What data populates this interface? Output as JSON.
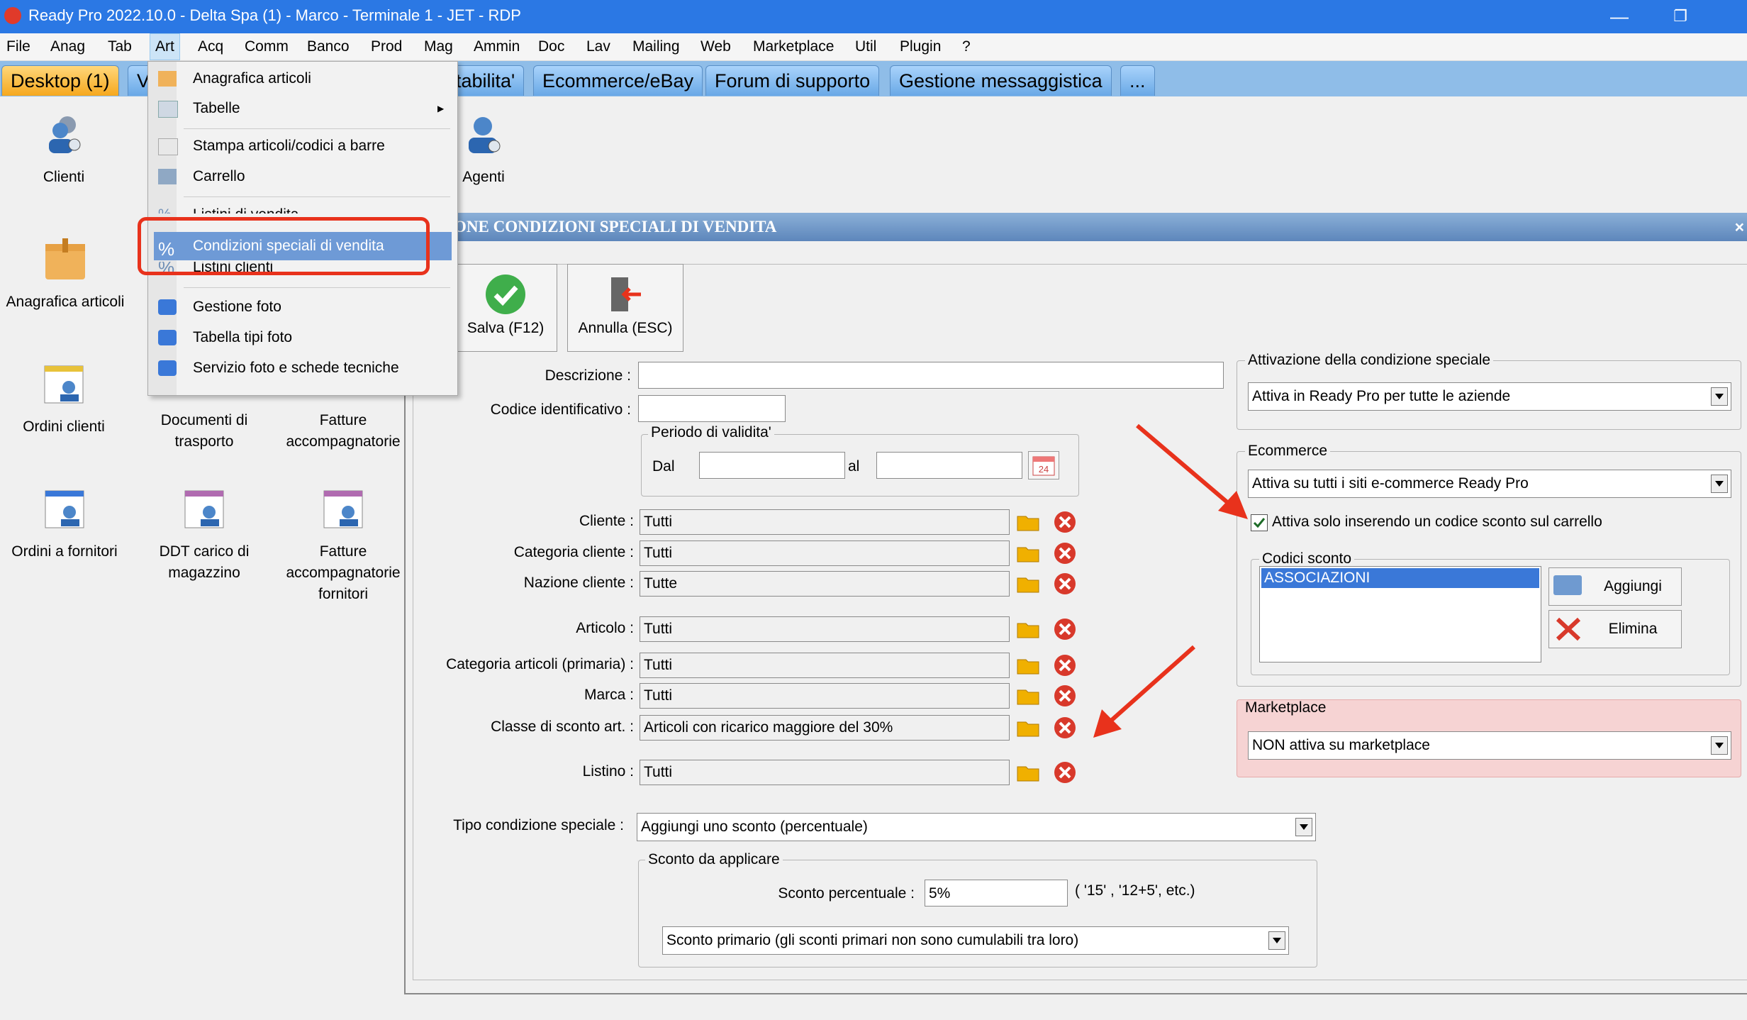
{
  "window": {
    "title": "Ready Pro 2022.10.0 - Delta Spa (1) - Marco - Terminale 1 - JET - RDP"
  },
  "menubar": [
    "File",
    "Anag",
    "Tab",
    "Art",
    "Acq",
    "Comm",
    "Banco",
    "Prod",
    "Mag",
    "Ammin",
    "Doc",
    "Lav",
    "Mailing",
    "Web",
    "Marketplace",
    "Util",
    "Plugin",
    "?"
  ],
  "tabs": [
    "Desktop (1)",
    "V",
    "tabilita'",
    "Ecommerce/eBay",
    "Forum di supporto",
    "Gestione messaggistica",
    "..."
  ],
  "desktop_icons": {
    "clienti": "Clienti",
    "anagrafica": "Anagrafica articoli",
    "agenti": "Agenti",
    "ordini_clienti": "Ordini clienti",
    "documenti_l1": "Documenti di",
    "documenti_l2": "trasporto",
    "fatture_l1": "Fatture",
    "fatture_l2": "accompagnatorie",
    "ordini_fornitori": "Ordini a fornitori",
    "ddt_l1": "DDT carico di",
    "ddt_l2": "magazzino",
    "fatt_forn_l1": "Fatture",
    "fatt_forn_l2": "accompagnatorie",
    "fatt_forn_l3": "fornitori"
  },
  "dropdown": {
    "items": [
      "Anagrafica articoli",
      "Tabelle",
      "Stampa articoli/codici a barre",
      "Carrello",
      "Listini di vendita",
      "Condizioni speciali di vendita",
      "Listini clienti",
      "Gestione foto",
      "Tabella tipi foto",
      "Servizio foto e schede tecniche"
    ],
    "submenu_arrow": "▶"
  },
  "panel": {
    "header": "ONE CONDIZIONI SPECIALI DI VENDITA",
    "save_label": "Salva (F12)",
    "cancel_label": "Annulla (ESC)",
    "descrizione_label": "Descrizione :",
    "codice_label": "Codice identificativo :",
    "periodo_title": "Periodo di validita'",
    "dal_label": "Dal",
    "al_label": "al",
    "calendar_day": "24",
    "rows": [
      {
        "label": "Cliente :",
        "value": "Tutti"
      },
      {
        "label": "Categoria cliente :",
        "value": "Tutti"
      },
      {
        "label": "Nazione cliente :",
        "value": "Tutte"
      },
      {
        "label": "Articolo :",
        "value": "Tutti"
      },
      {
        "label": "Categoria articoli (primaria) :",
        "value": "Tutti"
      },
      {
        "label": "Marca :",
        "value": "Tutti"
      },
      {
        "label": "Classe di sconto art. :",
        "value": "Articoli con ricarico maggiore del 30%"
      },
      {
        "label": "Listino :",
        "value": "Tutti"
      }
    ],
    "tipo_label": "Tipo condizione speciale :",
    "tipo_value": "Aggiungi uno sconto (percentuale)",
    "sconto_group": "Sconto da applicare",
    "sconto_label": "Sconto percentuale :",
    "sconto_value": "5%",
    "sconto_hint": "( '15' ,  '12+5', etc.)",
    "sconto_tipo": "Sconto primario (gli sconti primari non sono cumulabili tra loro)",
    "attivazione_title": "Attivazione della condizione speciale",
    "attivazione_value": "Attiva in Ready Pro per tutte le aziende",
    "ecommerce_title": "Ecommerce",
    "ecommerce_value": "Attiva su tutti i siti e-commerce Ready Pro",
    "checkbox_label": "Attiva solo inserendo un codice sconto sul carrello",
    "codici_title": "Codici sconto",
    "codici_items": [
      "ASSOCIAZIONI"
    ],
    "aggiungi": "Aggiungi",
    "elimina": "Elimina",
    "marketplace_title": "Marketplace",
    "marketplace_value": "NON attiva su marketplace"
  },
  "colors": {
    "accent": "#2b78e4",
    "highlight": "#e8321c",
    "marketplace_bg": "#f6d3d3"
  }
}
